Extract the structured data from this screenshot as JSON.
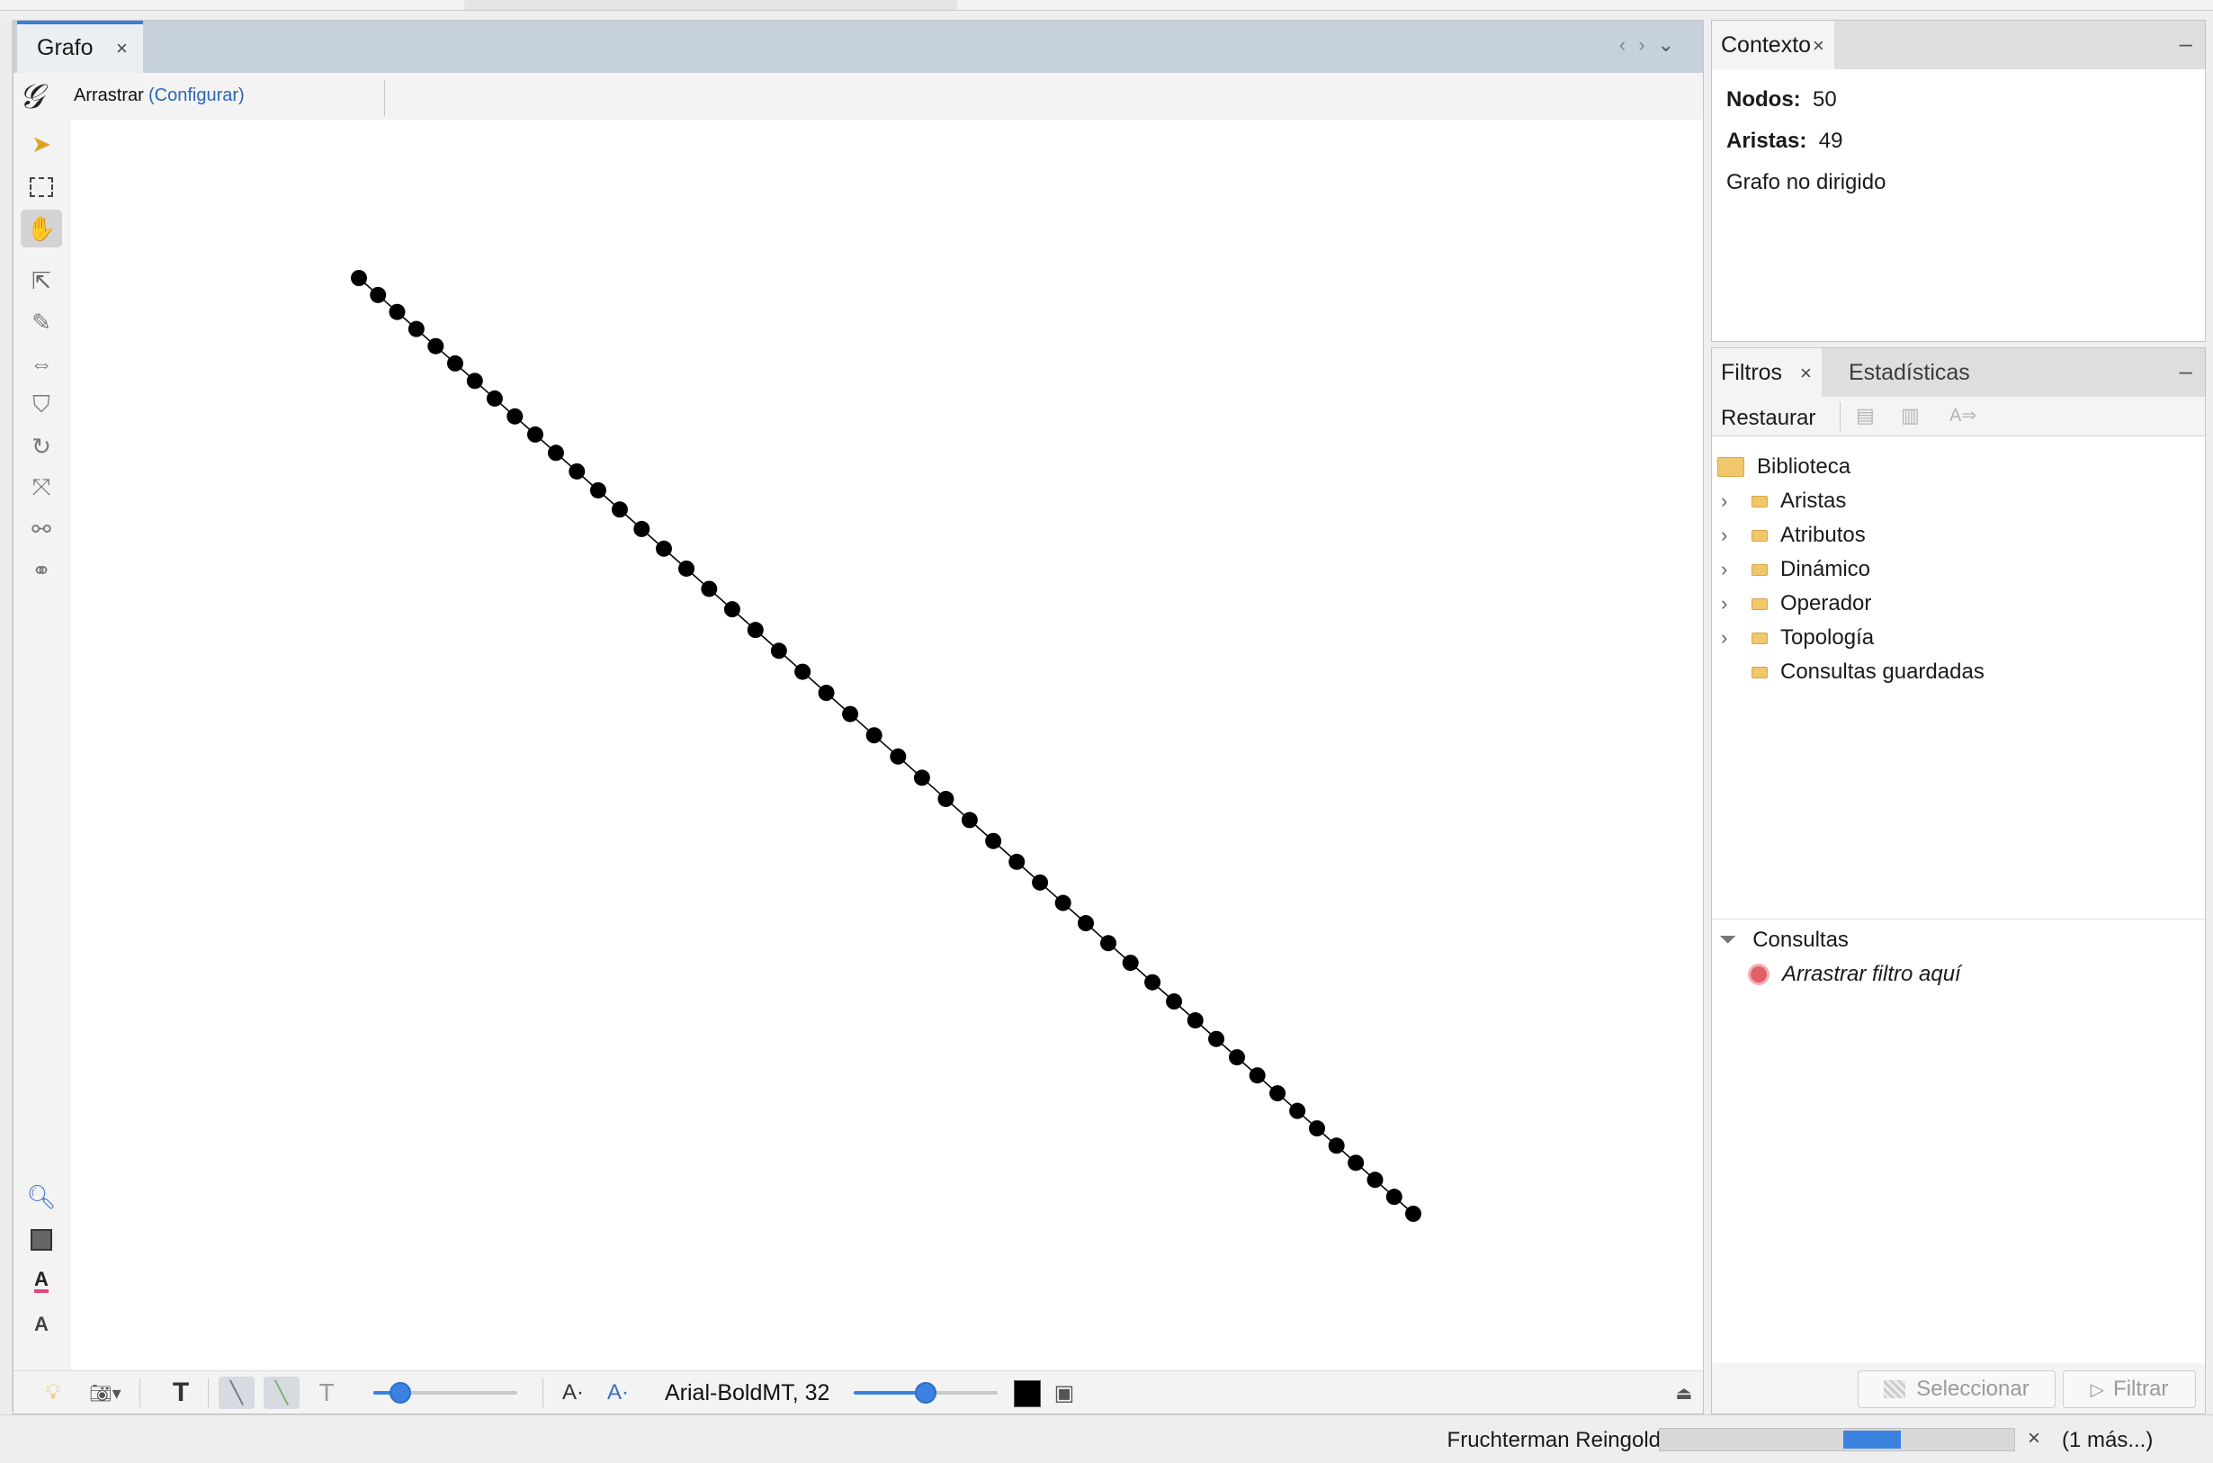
{
  "graph_tab": {
    "title": "Grafo",
    "close": "×"
  },
  "tool": {
    "name": "Arrastrar",
    "config_link": "(Configurar)"
  },
  "graph": {
    "node_count": 50,
    "node_color": "#000000",
    "edge_color": "#000000"
  },
  "bottom_toolbar": {
    "label_font": "Arial-BoldMT, 32",
    "label_size_level": 0.18,
    "font_size_level": 0.5,
    "label_color": "#000000"
  },
  "context": {
    "tab": "Contexto",
    "nodes_label": "Nodos:",
    "nodes_value": "50",
    "edges_label": "Aristas:",
    "edges_value": "49",
    "graph_type": "Grafo no dirigido"
  },
  "filters": {
    "tab_active": "Filtros",
    "tab_inactive": "Estadísticas",
    "restore": "Restaurar",
    "library": "Biblioteca",
    "categories": [
      "Aristas",
      "Atributos",
      "Dinámico",
      "Operador",
      "Topología"
    ],
    "saved_queries": "Consultas guardadas",
    "queries": "Consultas",
    "drop_hint": "Arrastrar filtro aquí",
    "select_button": "Seleccionar",
    "filter_button": "Filtrar"
  },
  "status": {
    "task": "Fruchterman Reingold",
    "progress_level": 0.45,
    "more": "(1 más...)"
  },
  "colors": {
    "accent": "#3b82e0",
    "tab_bar": "#c7d1dc",
    "link": "#2a64b8"
  }
}
